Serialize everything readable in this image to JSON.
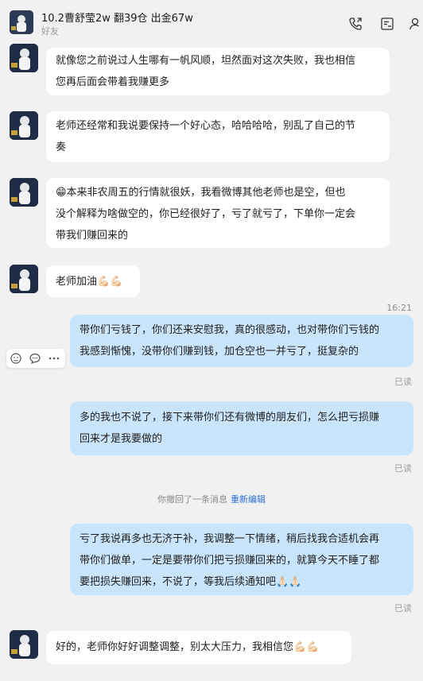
{
  "header": {
    "title": "10.2曹舒莹2w 翻39仓 出金67w",
    "subtitle": "好友",
    "icons": [
      "call-icon",
      "list-icon",
      "add-user-icon"
    ]
  },
  "messages": [
    {
      "from": "friend",
      "lines": [
        "就像您之前说过人生哪有一帆风顺，坦然面对这次失败，我也相信",
        "您再后面会带着我赚更多"
      ]
    },
    {
      "from": "friend",
      "lines": [
        "老师还经常和我说要保持一个好心态，哈哈哈哈，别乱了自己的节",
        "奏"
      ]
    },
    {
      "from": "friend",
      "lines": [
        "😁本来非农周五的行情就很妖，我看微博其他老师也是空，但也",
        "没个解释为啥做空的，你已经很好了，亏了就亏了，下单你一定会",
        "带我们赚回来的"
      ]
    },
    {
      "from": "friend",
      "lines": [
        "老师加油💪🏻💪🏻"
      ]
    },
    {
      "from": "me",
      "lines": [
        "带你们亏钱了，你们还来安慰我，真的很感动，也对带你们亏钱的",
        "我感到惭愧，没带你们赚到钱，加仓空也一并亏了，挺复杂的"
      ],
      "status": "已读"
    },
    {
      "from": "me",
      "lines": [
        "多的我也不说了，接下来带你们还有微博的朋友们，怎么把亏损赚",
        "回来才是我要做的"
      ],
      "status": "已读"
    },
    {
      "from": "me",
      "lines": [
        "亏了我说再多也无济于补，我调整一下情绪，稍后找我合适机会再",
        "带你们做单，一定是要带你们把亏损赚回来的，就算今天不睡了都",
        "要把损失赚回来，不说了，等我后续通知吧🙏🏻🙏🏻"
      ],
      "status": "已读"
    },
    {
      "from": "friend",
      "lines": [
        "好的，老师你好好调整调整，别太大压力，我相信您💪🏻💪🏻"
      ]
    }
  ],
  "timestamp": "16:21",
  "recall_notice": {
    "text": "你撤回了一条消息",
    "action": "重新编辑"
  },
  "hover_tools": [
    "add-emoji-icon",
    "comment-icon",
    "more-icon"
  ],
  "colors": {
    "background": "#f1f1f1",
    "friend_bubble": "#ffffff",
    "my_bubble": "#c9e5fb",
    "link": "#2c70d8"
  }
}
